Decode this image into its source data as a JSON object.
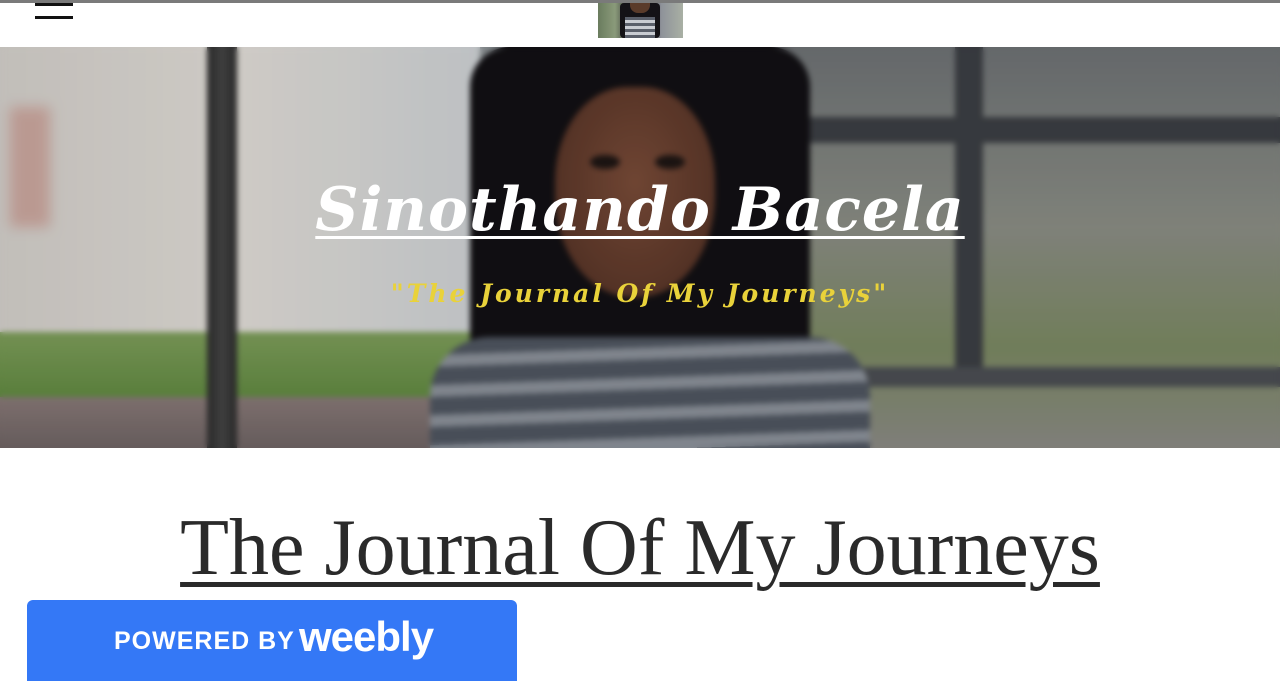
{
  "header": {
    "menu_icon": "hamburger-menu-icon",
    "logo_alt": "site logo thumbnail"
  },
  "hero": {
    "title": "Sinothando Bacela",
    "tagline": "\"The Journal Of My Journeys\""
  },
  "main": {
    "heading": "The Journal Of My Journeys"
  },
  "badge": {
    "powered_by": "POWERED BY",
    "brand": "weebly",
    "color": "#3478f6"
  },
  "colors": {
    "tagline": "#e9d23a",
    "heading_text": "#2a2a2a"
  }
}
